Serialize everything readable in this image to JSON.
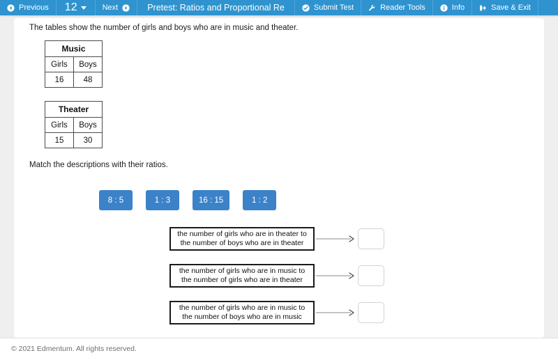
{
  "toolbar": {
    "previous_label": "Previous",
    "previous_icon": "arrow-circle-left-icon",
    "page_number": "12",
    "page_caret_icon": "chevron-down-icon",
    "next_label": "Next",
    "next_icon": "arrow-circle-right-icon",
    "title": "Pretest: Ratios and Proportional Re",
    "submit_label": "Submit Test",
    "submit_icon": "check-circle-icon",
    "reader_tools_label": "Reader Tools",
    "reader_tools_icon": "wrench-icon",
    "info_label": "Info",
    "info_icon": "info-circle-icon",
    "save_exit_label": "Save & Exit",
    "save_exit_icon": "sign-out-icon",
    "background_color": "#2e93cf"
  },
  "question": {
    "intro": "The tables show the number of girls and boys who are in music and theater.",
    "instruction": "Match the descriptions with their ratios.",
    "tables": [
      {
        "title": "Music",
        "headers": [
          "Girls",
          "Boys"
        ],
        "values": [
          "16",
          "48"
        ]
      },
      {
        "title": "Theater",
        "headers": [
          "Girls",
          "Boys"
        ],
        "values": [
          "15",
          "30"
        ]
      }
    ],
    "tiles": [
      {
        "label": "8 : 5"
      },
      {
        "label": "1 : 3"
      },
      {
        "label": "16 : 15"
      },
      {
        "label": "1 : 2"
      }
    ],
    "tile_color": "#3c82c8",
    "match_rows": [
      {
        "line1": "the number of girls who are in theater to",
        "line2": "the number of boys who are in theater",
        "answer": ""
      },
      {
        "line1": "the number of girls who are in music to",
        "line2": "the number of girls who are in theater",
        "answer": ""
      },
      {
        "line1": "the number of girls who are in music to",
        "line2": "the number of boys who are in music",
        "answer": ""
      }
    ]
  },
  "footer": {
    "copyright": "© 2021 Edmentum. All rights reserved."
  }
}
